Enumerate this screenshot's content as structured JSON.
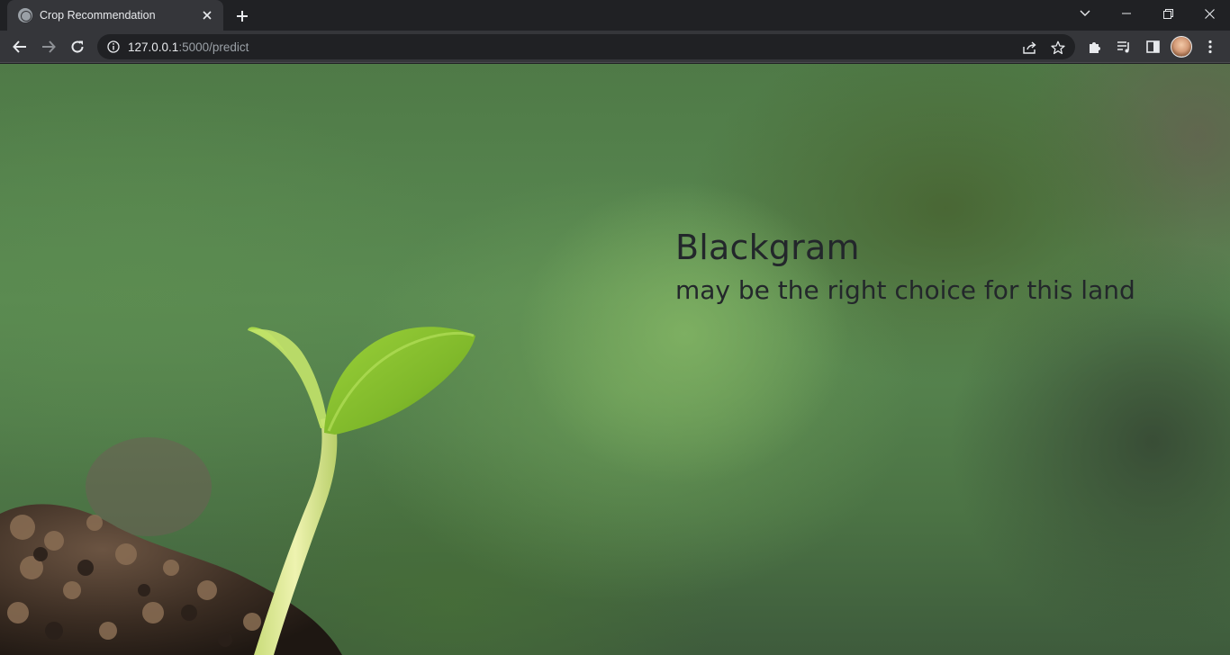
{
  "browser": {
    "tab": {
      "title": "Crop Recommendation",
      "favicon": "globe-icon"
    },
    "address": {
      "host": "127.0.0.1",
      "path": ":5000/predict"
    },
    "colors": {
      "frame": "#202124",
      "toolbar": "#35363a",
      "text": "#e8eaed"
    }
  },
  "page": {
    "crop_name": "Blackgram",
    "crop_message": "may be the right choice for this land",
    "text_color": "#23272b"
  }
}
